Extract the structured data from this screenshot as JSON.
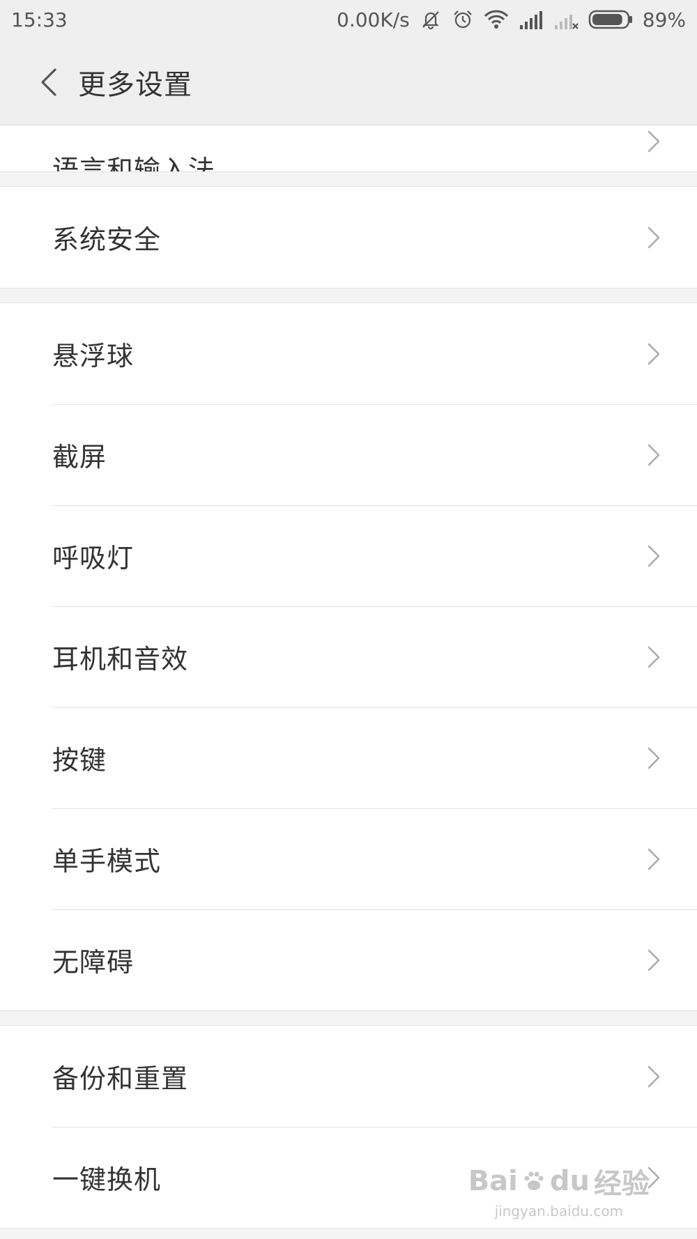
{
  "status_bar": {
    "time": "15:33",
    "network_speed": "0.00K/s",
    "battery_percent": "89%",
    "battery_level": 0.89,
    "icons": [
      "mute-icon",
      "alarm-icon",
      "wifi-icon",
      "signal-icon",
      "no-signal-icon",
      "battery-icon"
    ]
  },
  "header": {
    "title": "更多设置",
    "back_icon": "chevron-left-icon"
  },
  "settings": {
    "partial_item": "语言和输入法",
    "group_security": [
      "系统安全"
    ],
    "group_features": [
      "悬浮球",
      "截屏",
      "呼吸灯",
      "耳机和音效",
      "按键",
      "单手模式",
      "无障碍"
    ],
    "group_backup": [
      "备份和重置",
      "一键换机"
    ]
  },
  "watermark": {
    "brand": "Bai",
    "brand2": "du",
    "label": "经验",
    "url": "jingyan.baidu.com"
  }
}
